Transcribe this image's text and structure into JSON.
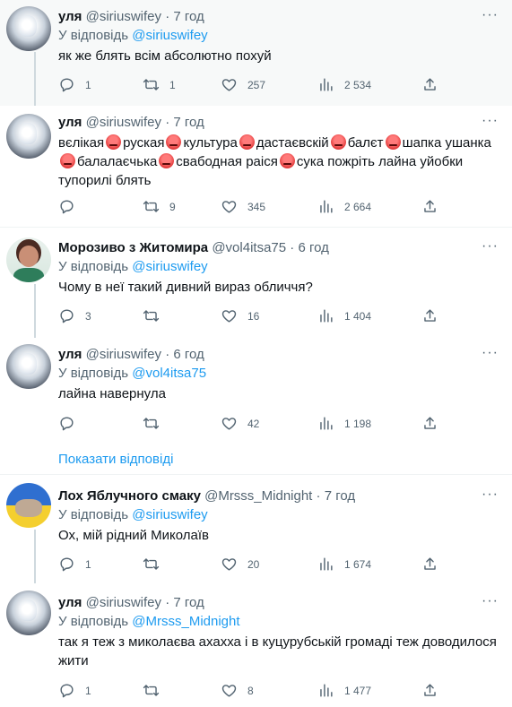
{
  "tweets": [
    {
      "name": "уля",
      "handle": "@siriuswifey",
      "dot": "·",
      "time": "7 год",
      "reply_prefix": "У відповідь",
      "reply_to": "@siriuswifey",
      "text": "як же блять всім абсолютно похуй",
      "replies": "1",
      "retweets": "1",
      "likes": "257",
      "views": "2 534"
    },
    {
      "name": "уля",
      "handle": "@siriuswifey",
      "dot": "·",
      "time": "7 год",
      "segments": [
        "вєлікая",
        "руская",
        "культура",
        "дастаєвскій",
        "балєт",
        "шапка ушанка",
        "балалаєчька",
        "свабодная раіся",
        "сука пожріть лайна уйобки тупорилі блять"
      ],
      "replies": "",
      "retweets": "9",
      "likes": "345",
      "views": "2 664"
    },
    {
      "name": "Морозиво з Житомира",
      "handle": "@vol4itsa75",
      "dot": "·",
      "time": "6 год",
      "reply_prefix": "У відповідь",
      "reply_to": "@siriuswifey",
      "text": "Чому в неї такий дивний вираз обличчя?",
      "replies": "3",
      "retweets": "",
      "likes": "16",
      "views": "1 404"
    },
    {
      "name": "уля",
      "handle": "@siriuswifey",
      "dot": "·",
      "time": "6 год",
      "reply_prefix": "У відповідь",
      "reply_to": "@vol4itsa75",
      "text": "лайна навернула",
      "replies": "",
      "retweets": "",
      "likes": "42",
      "views": "1 198"
    },
    {
      "name": "Лох Яблучного смаку",
      "handle": "@Mrsss_Midnight",
      "dot": "·",
      "time": "7 год",
      "reply_prefix": "У відповідь",
      "reply_to": "@siriuswifey",
      "text": "Ох, мій рідний Миколаїв",
      "replies": "1",
      "retweets": "",
      "likes": "20",
      "views": "1 674"
    },
    {
      "name": "уля",
      "handle": "@siriuswifey",
      "dot": "·",
      "time": "7 год",
      "reply_prefix": "У відповідь",
      "reply_to": "@Mrsss_Midnight",
      "text": "так я теж з миколаєва ахахха і в куцурубській громаді теж доводилося жити",
      "replies": "1",
      "retweets": "",
      "likes": "8",
      "views": "1 477"
    }
  ],
  "show_replies": "Показати відповіді",
  "more_glyph": "···"
}
